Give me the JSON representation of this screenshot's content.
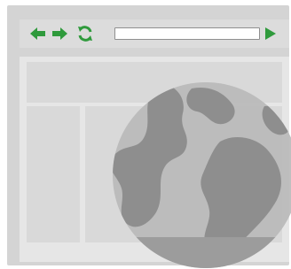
{
  "colors": {
    "accent": "#2f9a3c",
    "frame": "#d4d4d4",
    "toolbar": "#dcdcdc",
    "content_bg": "#e6e6e6",
    "content_block": "#d9d9d9",
    "globe_water": "#b8b8b8",
    "globe_land": "#8e8e8e"
  },
  "toolbar": {
    "back_icon": "arrow-left-icon",
    "forward_icon": "arrow-right-icon",
    "refresh_icon": "refresh-icon",
    "go_icon": "play-icon",
    "address_value": ""
  },
  "overlay": {
    "icon": "globe-icon"
  }
}
